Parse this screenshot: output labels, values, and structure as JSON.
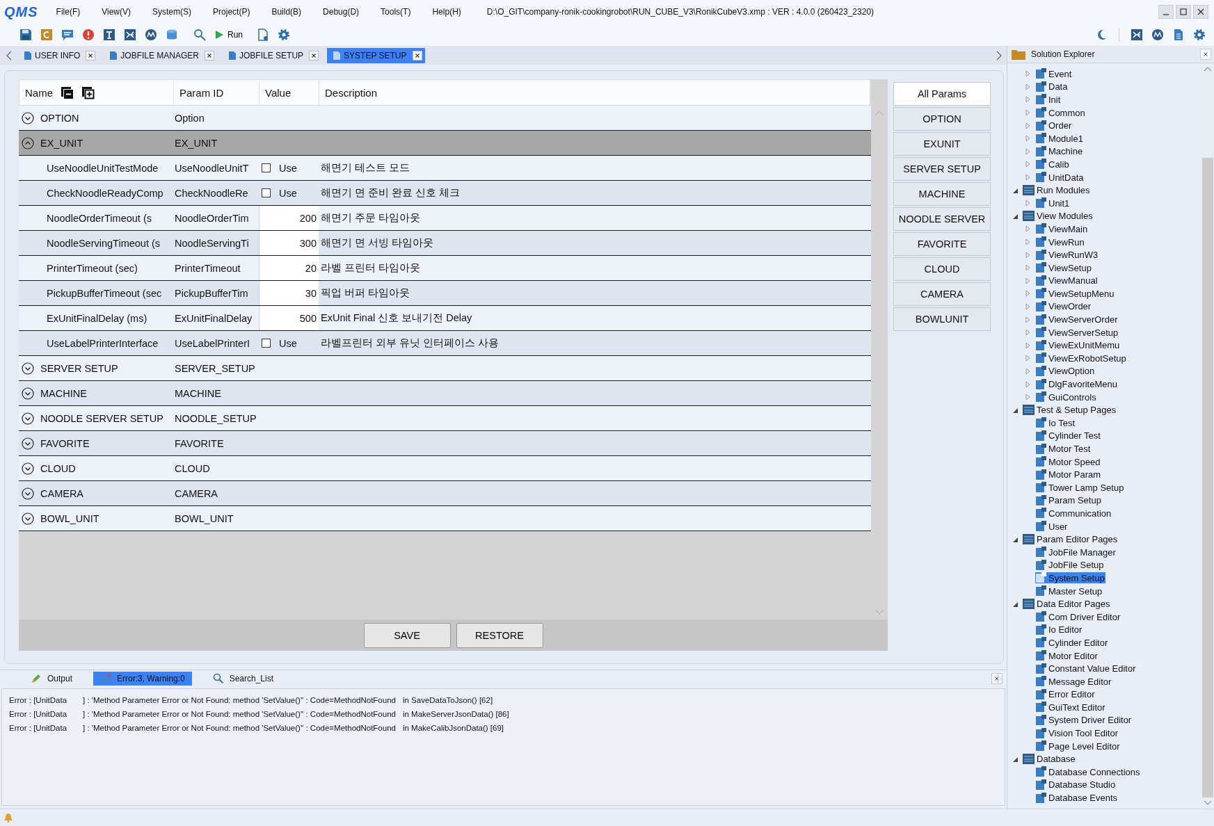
{
  "window": {
    "logo": "QMS",
    "menu": [
      "File(F)",
      "View(V)",
      "System(S)",
      "Project(P)",
      "Build(B)",
      "Debug(D)",
      "Tools(T)",
      "Help(H)"
    ],
    "title": "D:\\O_GIT\\company-ronik-cookingrobot\\RUN_CUBE_V3\\RonikCubeV3.xmp :  VER : 4.0.0 (260423_2320)"
  },
  "toolbar": {
    "run_label": "Run"
  },
  "tabs": [
    {
      "label": "USER INFO",
      "selected": false
    },
    {
      "label": "JOBFILE MANAGER",
      "selected": false
    },
    {
      "label": "JOBFILE SETUP",
      "selected": false
    },
    {
      "label": "SYSTEP SETUP",
      "selected": true
    }
  ],
  "grid": {
    "columns": [
      "Name",
      "Param ID",
      "Value",
      "Description"
    ],
    "groups": [
      {
        "name": "OPTION",
        "param_id": "Option",
        "expanded": false,
        "selected": false
      },
      {
        "name": "EX_UNIT",
        "param_id": "EX_UNIT",
        "expanded": true,
        "selected": true,
        "params": [
          {
            "kind": "checkbox",
            "name": "UseNoodleUnitTestMode",
            "param_id": "UseNoodleUnitT",
            "checked": false,
            "option": "Use",
            "description": "해면기 테스트 모드"
          },
          {
            "kind": "checkbox",
            "name": "CheckNoodleReadyComp",
            "param_id": "CheckNoodleRe",
            "checked": false,
            "option": "Use",
            "description": "해면기 면 준비 완료 신호 체크"
          },
          {
            "kind": "number",
            "name": "NoodleOrderTimeout (s",
            "param_id": "NoodleOrderTim",
            "value": "200",
            "description": "해면기 주문 타임아웃"
          },
          {
            "kind": "number",
            "name": "NoodleServingTimeout (s",
            "param_id": "NoodleServingTi",
            "value": "300",
            "description": "해면기 면 서빙 타임아웃"
          },
          {
            "kind": "number",
            "name": "PrinterTimeout (sec)",
            "param_id": "PrinterTimeout",
            "value": "20",
            "description": "라벨 프린터 타임아웃"
          },
          {
            "kind": "number",
            "name": "PickupBufferTimeout (sec",
            "param_id": "PickupBufferTim",
            "value": "30",
            "description": "픽업 버퍼 타임아웃"
          },
          {
            "kind": "number",
            "name": "ExUnitFinalDelay (ms)",
            "param_id": "ExUnitFinalDelay",
            "value": "500",
            "description": "ExUnit Final 신호 보내기전 Delay"
          },
          {
            "kind": "checkbox",
            "name": "UseLabelPrinterInterface",
            "param_id": "UseLabelPrinterI",
            "checked": false,
            "option": "Use",
            "description": "라벨프린터 외부 유닛 인터페이스 사용"
          }
        ]
      },
      {
        "name": "SERVER SETUP",
        "param_id": "SERVER_SETUP",
        "expanded": false,
        "selected": false
      },
      {
        "name": "MACHINE",
        "param_id": "MACHINE",
        "expanded": false,
        "selected": false
      },
      {
        "name": "NOODLE SERVER SETUP",
        "param_id": "NOODLE_SETUP",
        "expanded": false,
        "selected": false
      },
      {
        "name": "FAVORITE",
        "param_id": "FAVORITE",
        "expanded": false,
        "selected": false
      },
      {
        "name": "CLOUD",
        "param_id": "CLOUD",
        "expanded": false,
        "selected": false
      },
      {
        "name": "CAMERA",
        "param_id": "CAMERA",
        "expanded": false,
        "selected": false
      },
      {
        "name": "BOWL_UNIT",
        "param_id": "BOWL_UNIT",
        "expanded": false,
        "selected": false
      }
    ]
  },
  "categories": [
    {
      "label": "All Params",
      "selected": true
    },
    {
      "label": "OPTION",
      "selected": false
    },
    {
      "label": "EXUNIT",
      "selected": false
    },
    {
      "label": "SERVER SETUP",
      "selected": false
    },
    {
      "label": "MACHINE",
      "selected": false
    },
    {
      "label": "NOODLE SERVER",
      "selected": false
    },
    {
      "label": "FAVORITE",
      "selected": false
    },
    {
      "label": "CLOUD",
      "selected": false
    },
    {
      "label": "CAMERA",
      "selected": false
    },
    {
      "label": "BOWLUNIT",
      "selected": false
    }
  ],
  "actions": [
    "SAVE",
    "RESTORE"
  ],
  "output": {
    "tabs": [
      {
        "label": "Output",
        "selected": false
      },
      {
        "label": "Error:3, Warning:0",
        "selected": true
      },
      {
        "label": "Search_List",
        "selected": false
      }
    ],
    "lines": [
      {
        "source": "Error : [UnitData",
        "message": "] : 'Method Parameter Error or Not Found: method 'SetValue()'' : Code=MethodNotFound",
        "location": "in SaveDataToJson() [62]"
      },
      {
        "source": "Error : [UnitData",
        "message": "] : 'Method Parameter Error or Not Found: method 'SetValue()'' : Code=MethodNotFound",
        "location": "in MakeServerJsonData() [86]"
      },
      {
        "source": "Error : [UnitData",
        "message": "] : 'Method Parameter Error or Not Found: method 'SetValue()'' : Code=MethodNotFound",
        "location": "in MakeCalibJsonData() [69]"
      }
    ]
  },
  "explorer": {
    "title": "Solution Explorer",
    "scrolled_items": [
      {
        "label": "Event",
        "expanded": false
      },
      {
        "label": "Data",
        "expanded": false
      },
      {
        "label": "Init",
        "expanded": false
      },
      {
        "label": "Common",
        "expanded": false
      },
      {
        "label": "Order",
        "expanded": false
      },
      {
        "label": "Module1",
        "expanded": false
      },
      {
        "label": "Machine",
        "expanded": false
      },
      {
        "label": "Calib",
        "expanded": false
      },
      {
        "label": "UnitData",
        "expanded": false
      }
    ],
    "tree": [
      {
        "label": "Run Modules",
        "expanded": true,
        "children": [
          {
            "label": "Unit1",
            "expanded": false
          }
        ]
      },
      {
        "label": "View Modules",
        "expanded": true,
        "children": [
          {
            "label": "ViewMain",
            "expanded": false
          },
          {
            "label": "ViewRun",
            "expanded": false
          },
          {
            "label": "ViewRunW3",
            "expanded": false
          },
          {
            "label": "ViewSetup",
            "expanded": false
          },
          {
            "label": "ViewManual",
            "expanded": false
          },
          {
            "label": "ViewSetupMenu",
            "expanded": false
          },
          {
            "label": "ViewOrder",
            "expanded": false
          },
          {
            "label": "ViewServerOrder",
            "expanded": false
          },
          {
            "label": "ViewServerSetup",
            "expanded": false
          },
          {
            "label": "ViewExUnitMemu",
            "expanded": false
          },
          {
            "label": "ViewExRobotSetup",
            "expanded": false
          },
          {
            "label": "ViewOption",
            "expanded": false
          },
          {
            "label": "DlgFavoriteMenu",
            "expanded": false
          },
          {
            "label": "GuiControls",
            "expanded": false
          }
        ]
      },
      {
        "label": "Test & Setup Pages",
        "expanded": true,
        "children": [
          {
            "label": "Io Test"
          },
          {
            "label": "Cylinder Test"
          },
          {
            "label": "Motor Test"
          },
          {
            "label": "Motor Speed"
          },
          {
            "label": "Motor Param"
          },
          {
            "label": "Tower Lamp Setup"
          },
          {
            "label": "Param Setup"
          },
          {
            "label": "Communication"
          },
          {
            "label": "User"
          }
        ]
      },
      {
        "label": "Param Editor Pages",
        "expanded": true,
        "children": [
          {
            "label": "JobFile Manager",
            "selected": false
          },
          {
            "label": "JobFile Setup",
            "selected": false
          },
          {
            "label": "System Setup",
            "selected": true
          },
          {
            "label": "Master Setup",
            "selected": false
          }
        ]
      },
      {
        "label": "Data Editor Pages",
        "expanded": true,
        "children": [
          {
            "label": "Com Driver Editor"
          },
          {
            "label": "Io Editor"
          },
          {
            "label": "Cylinder Editor"
          },
          {
            "label": "Motor Editor"
          },
          {
            "label": "Constant Value Editor"
          },
          {
            "label": "Message Editor"
          },
          {
            "label": "Error Editor"
          },
          {
            "label": "GuiText Editor"
          },
          {
            "label": "System Driver Editor"
          },
          {
            "label": "Vision Tool Editor"
          },
          {
            "label": "Page Level Editor"
          }
        ]
      },
      {
        "label": "Database",
        "expanded": true,
        "children": [
          {
            "label": "Database Connections"
          },
          {
            "label": "Database Studio"
          },
          {
            "label": "Database Events"
          }
        ]
      }
    ]
  }
}
